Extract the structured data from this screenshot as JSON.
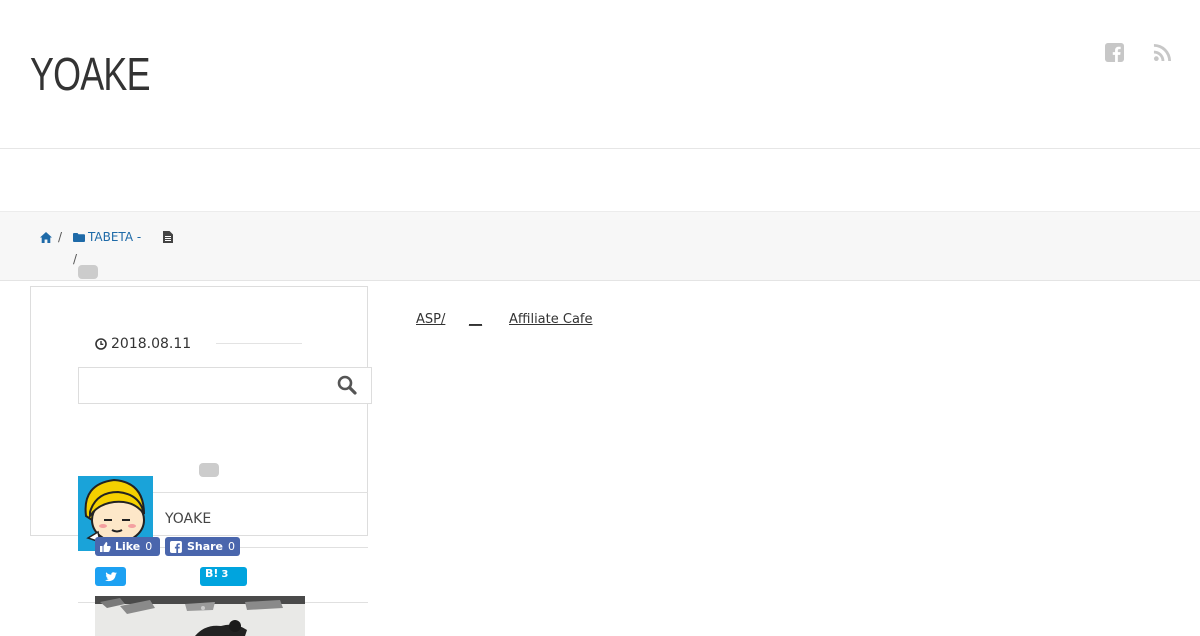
{
  "site": {
    "logo": "YOAKE"
  },
  "header": {
    "icons": [
      "facebook-icon",
      "rss-icon"
    ]
  },
  "breadcrumb": {
    "home_icon": "home-icon",
    "sep1": "/",
    "category_icon": "folder-icon",
    "category": "TABETA -",
    "post_icon": "file-icon",
    "sep2": "/"
  },
  "top_links": {
    "asp": "ASP/",
    "blank": "__",
    "affiliate": "Affiliate Cafe"
  },
  "post": {
    "date": "2018.08.11",
    "clock_icon": "clock-icon"
  },
  "search": {
    "placeholder": "",
    "icon": "search-icon"
  },
  "author": {
    "name": "YOAKE"
  },
  "share": {
    "fb_like_label": "Like",
    "fb_like_count": "0",
    "fb_share_label": "Share",
    "fb_share_count": "0",
    "hatena_label": "B!",
    "hatena_count": "3"
  },
  "colors": {
    "link": "#1e6aa8",
    "facebook": "#4a66ad",
    "twitter": "#1da1f2",
    "hatena": "#00a4de",
    "avatar_bg": "#1aa3d9"
  }
}
